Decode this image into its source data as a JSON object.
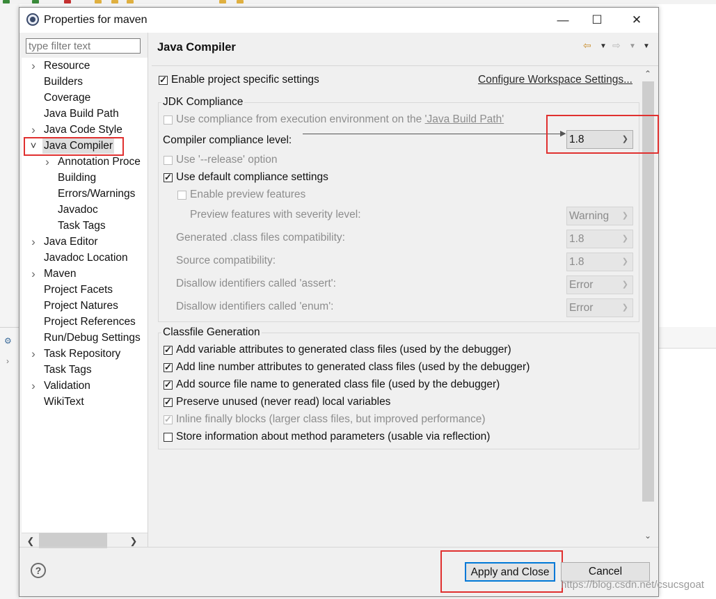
{
  "window": {
    "title": "Properties for maven",
    "minimize": "—",
    "maximize": "☐",
    "close": "✕"
  },
  "filter": {
    "placeholder": "type filter text"
  },
  "tree": {
    "items": [
      {
        "label": "Resource",
        "expandable": true,
        "indent": 0
      },
      {
        "label": "Builders",
        "expandable": false,
        "indent": 0
      },
      {
        "label": "Coverage",
        "expandable": false,
        "indent": 0
      },
      {
        "label": "Java Build Path",
        "expandable": false,
        "indent": 0
      },
      {
        "label": "Java Code Style",
        "expandable": true,
        "indent": 0
      },
      {
        "label": "Java Compiler",
        "expandable": true,
        "expanded": true,
        "indent": 0,
        "selected": true
      },
      {
        "label": "Annotation Proce",
        "expandable": true,
        "indent": 1
      },
      {
        "label": "Building",
        "expandable": false,
        "indent": 1
      },
      {
        "label": "Errors/Warnings",
        "expandable": false,
        "indent": 1
      },
      {
        "label": "Javadoc",
        "expandable": false,
        "indent": 1
      },
      {
        "label": "Task Tags",
        "expandable": false,
        "indent": 1
      },
      {
        "label": "Java Editor",
        "expandable": true,
        "indent": 0
      },
      {
        "label": "Javadoc Location",
        "expandable": false,
        "indent": 0
      },
      {
        "label": "Maven",
        "expandable": true,
        "indent": 0
      },
      {
        "label": "Project Facets",
        "expandable": false,
        "indent": 0
      },
      {
        "label": "Project Natures",
        "expandable": false,
        "indent": 0
      },
      {
        "label": "Project References",
        "expandable": false,
        "indent": 0
      },
      {
        "label": "Run/Debug Settings",
        "expandable": false,
        "indent": 0
      },
      {
        "label": "Task Repository",
        "expandable": true,
        "indent": 0
      },
      {
        "label": "Task Tags",
        "expandable": false,
        "indent": 0
      },
      {
        "label": "Validation",
        "expandable": true,
        "indent": 0
      },
      {
        "label": "WikiText",
        "expandable": false,
        "indent": 0
      }
    ]
  },
  "page": {
    "title": "Java Compiler",
    "enable_project_settings": "Enable project specific settings",
    "configure_workspace_link": "Configure Workspace Settings...",
    "jdk": {
      "group_title": "JDK Compliance",
      "use_env": "Use compliance from execution environment on the ",
      "use_env_link": "'Java Build Path'",
      "level_label": "Compiler compliance level:",
      "level_value": "1.8",
      "release_option": "Use '--release' option",
      "use_default": "Use default compliance settings",
      "enable_preview": "Enable preview features",
      "preview_severity_label": "Preview features with severity level:",
      "preview_severity_value": "Warning",
      "class_compat_label": "Generated .class files compatibility:",
      "class_compat_value": "1.8",
      "source_compat_label": "Source compatibility:",
      "source_compat_value": "1.8",
      "assert_label": "Disallow identifiers called 'assert':",
      "assert_value": "Error",
      "enum_label": "Disallow identifiers called 'enum':",
      "enum_value": "Error"
    },
    "classfile": {
      "group_title": "Classfile Generation",
      "variable_attrs": "Add variable attributes to generated class files (used by the debugger)",
      "line_number_attrs": "Add line number attributes to generated class files (used by the debugger)",
      "source_file_name": "Add source file name to generated class file (used by the debugger)",
      "preserve_unused": "Preserve unused (never read) local variables",
      "inline_finally": "Inline finally blocks (larger class files, but improved performance)",
      "method_params": "Store information about method parameters (usable via reflection)"
    }
  },
  "footer": {
    "help": "?",
    "apply_close": "Apply and Close",
    "cancel": "Cancel"
  },
  "watermark": "https://blog.csdn.net/csucsgoat",
  "colors": {
    "highlight": "#e0302f",
    "accent": "#0078d7"
  }
}
